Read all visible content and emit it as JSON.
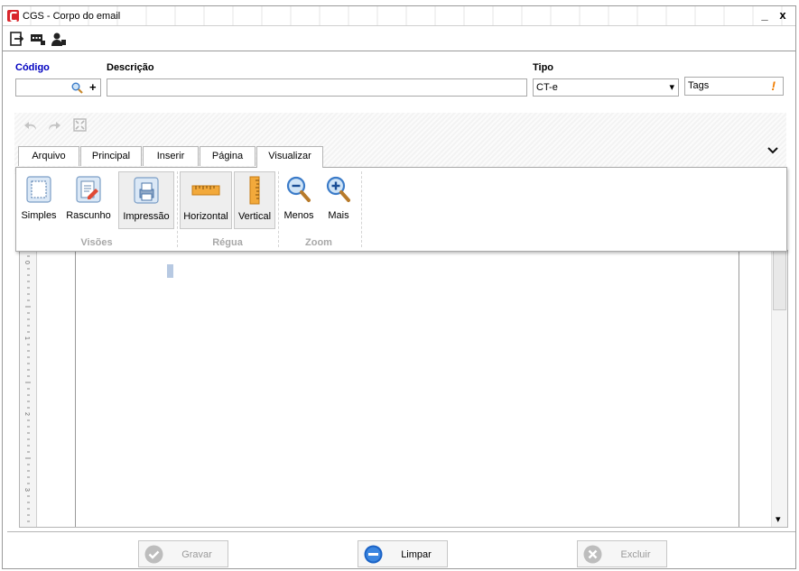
{
  "window": {
    "title": "CGS - Corpo do email",
    "minimize_label": "_",
    "close_label": "x"
  },
  "toolbar": {
    "icons": [
      "exit-icon",
      "messages-icon",
      "user-icon"
    ]
  },
  "form": {
    "codigo_label": "Código",
    "descricao_label": "Descrição",
    "tipo_label": "Tipo",
    "codigo_value": "",
    "descricao_value": "",
    "tipo_value": "CT-e",
    "tags_label": "Tags",
    "tags_alert": "!",
    "add_symbol": "+",
    "dropdown_arrow": "▾",
    "accent_label_color": "#0000c0"
  },
  "ribbon": {
    "tabs": [
      "Arquivo",
      "Principal",
      "Inserir",
      "Página",
      "Visualizar"
    ],
    "active_tab": "Visualizar",
    "collapse_symbol": "⌄",
    "buttons": {
      "simples": "Simples",
      "rascunho": "Rascunho",
      "impressao": "Impressão",
      "horizontal": "Horizontal",
      "vertical": "Vertical",
      "menos": "Menos",
      "mais": "Mais"
    },
    "groups": {
      "visoes": "Visões",
      "regua": "Régua",
      "zoom": "Zoom"
    }
  },
  "editor": {
    "ruler_numbers": [
      "0",
      "1",
      "2",
      "3"
    ],
    "scroll_down": "▾"
  },
  "footer": {
    "gravar": "Gravar",
    "limpar": "Limpar",
    "excluir": "Excluir"
  },
  "colors": {
    "primary_blue": "#1b63c6",
    "disabled_gray": "#b8b8b8",
    "alert_orange": "#f07c00"
  }
}
